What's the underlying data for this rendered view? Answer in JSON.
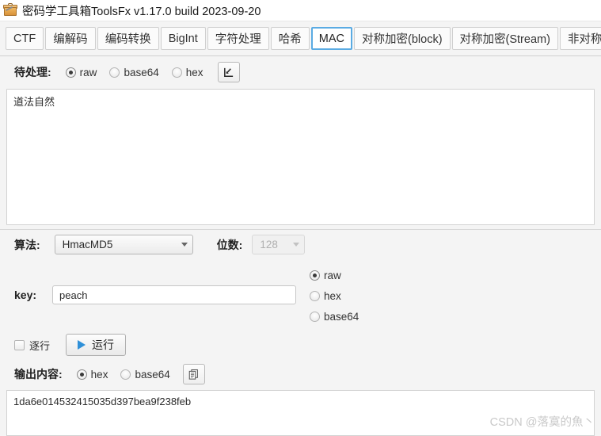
{
  "window": {
    "title": "密码学工具箱ToolsFx v1.17.0 build 2023-09-20",
    "icon": "toolbox-icon"
  },
  "tabs": [
    {
      "label": "CTF",
      "selected": false
    },
    {
      "label": "编解码",
      "selected": false
    },
    {
      "label": "编码转换",
      "selected": false
    },
    {
      "label": "BigInt",
      "selected": false
    },
    {
      "label": "字符处理",
      "selected": false
    },
    {
      "label": "哈希",
      "selected": false
    },
    {
      "label": "MAC",
      "selected": true
    },
    {
      "label": "对称加密(block)",
      "selected": false
    },
    {
      "label": "对称加密(Stream)",
      "selected": false
    },
    {
      "label": "非对称加密",
      "selected": false
    }
  ],
  "input_section": {
    "label": "待处理:",
    "encodings": [
      {
        "label": "raw",
        "selected": true
      },
      {
        "label": "base64",
        "selected": false
      },
      {
        "label": "hex",
        "selected": false
      }
    ],
    "import_button_icon": "import-file-icon",
    "textarea_value": "道法自然",
    "textarea_placeholder": ""
  },
  "algorithm_section": {
    "algorithm_label": "算法:",
    "algorithm_value": "HmacMD5",
    "algorithm_options": [
      "HmacMD5"
    ],
    "bits_label": "位数:",
    "bits_value": "128",
    "bits_disabled": true
  },
  "key_section": {
    "label": "key:",
    "value": "peach",
    "placeholder": "",
    "encodings": [
      {
        "label": "raw",
        "selected": true
      },
      {
        "label": "hex",
        "selected": false
      },
      {
        "label": "base64",
        "selected": false
      }
    ]
  },
  "run_section": {
    "line_by_line_label": "逐行",
    "line_by_line_checked": false,
    "run_button_label": "运行",
    "run_button_icon": "play-icon"
  },
  "output_section": {
    "label": "输出内容:",
    "encodings": [
      {
        "label": "hex",
        "selected": true
      },
      {
        "label": "base64",
        "selected": false
      }
    ],
    "copy_button_icon": "copy-icon",
    "result": "1da6e014532415035d397bea9f238feb"
  },
  "watermark": {
    "text": "CSDN @落寞的魚丶"
  },
  "colors": {
    "accent": "#5aabe3",
    "play": "#2f90d8",
    "background": "#f4f4f4",
    "panel": "#ffffff",
    "border": "#cfcfcf",
    "watermark": "#c9c9c9"
  }
}
